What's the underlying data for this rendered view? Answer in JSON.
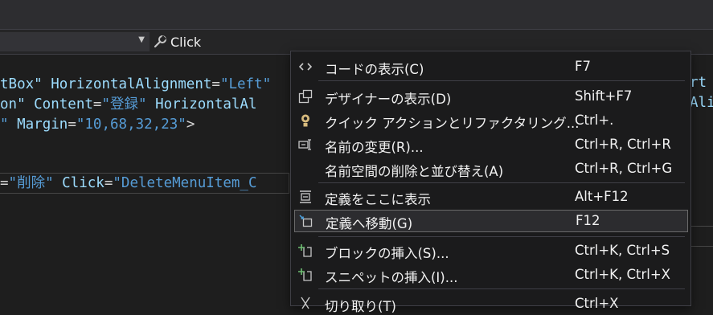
{
  "navbar": {
    "event_label": "Click"
  },
  "code": {
    "line1": {
      "a": "tBox\"",
      "b": " HorizontalAlignment",
      "c": "=",
      "d": "\"Left\""
    },
    "line2": {
      "a": "on\"",
      "b": " Content",
      "c": "=",
      "d": "\"登録\"",
      "e": " HorizontalAl"
    },
    "line3": {
      "a": "\"",
      "b": " Margin",
      "c": "=",
      "d": "\"10,68,32,23\"",
      "e": ">"
    },
    "line4": {
      "a": "=",
      "b": "\"削除\"",
      "c": " Click",
      "d": "=",
      "e": "\"DeleteMenuItem_C"
    },
    "right1": "rt",
    "right2": "Ali"
  },
  "menu": {
    "items": [
      {
        "icon": "code-icon",
        "label": "コードの表示(C)",
        "shortcut": "F7"
      },
      {
        "icon": "designer-icon",
        "label": "デザイナーの表示(D)",
        "shortcut": "Shift+F7"
      },
      {
        "icon": "lightbulb-icon",
        "label": "クイック アクションとリファクタリング...",
        "shortcut": "Ctrl+."
      },
      {
        "icon": "rename-icon",
        "label": "名前の変更(R)...",
        "shortcut": "Ctrl+R, Ctrl+R"
      },
      {
        "icon": "",
        "label": "名前空間の削除と並び替え(A)",
        "shortcut": "Ctrl+R, Ctrl+G"
      },
      {
        "icon": "peek-definition-icon",
        "label": "定義をここに表示",
        "shortcut": "Alt+F12"
      },
      {
        "icon": "goto-definition-icon",
        "label": "定義へ移動(G)",
        "shortcut": "F12"
      },
      {
        "icon": "insert-block-icon",
        "label": "ブロックの挿入(S)...",
        "shortcut": "Ctrl+K, Ctrl+S"
      },
      {
        "icon": "insert-snippet-icon",
        "label": "スニペットの挿入(I)...",
        "shortcut": "Ctrl+K, Ctrl+X"
      },
      {
        "icon": "cut-icon",
        "label": "切り取り(T)",
        "shortcut": "Ctrl+X"
      }
    ]
  }
}
